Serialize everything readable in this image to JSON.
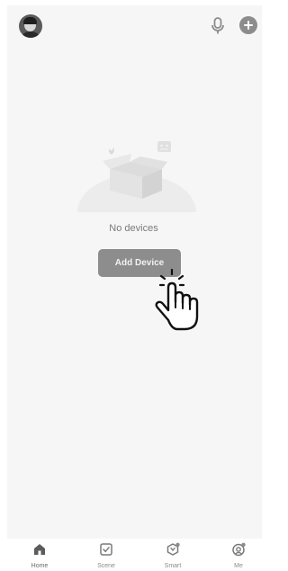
{
  "header": {
    "avatar": "user-avatar",
    "mic_icon": "microphone-icon",
    "add_icon": "plus-circle-icon"
  },
  "main": {
    "empty_text": "No devices",
    "add_button_label": "Add Device",
    "illustration": "empty-box-illustration",
    "hand_icon": "tap-hand-icon"
  },
  "tabbar": {
    "tabs": [
      {
        "label": "Home",
        "icon": "home-icon",
        "active": true
      },
      {
        "label": "Scene",
        "icon": "checkbox-icon",
        "active": false
      },
      {
        "label": "Smart",
        "icon": "smart-icon",
        "active": false
      },
      {
        "label": "Me",
        "icon": "profile-icon",
        "active": false
      }
    ]
  },
  "colors": {
    "background": "#f6f6f6",
    "button": "#8d8d8d",
    "text_muted": "#7a7a7a",
    "icon": "#8c8c8c"
  }
}
